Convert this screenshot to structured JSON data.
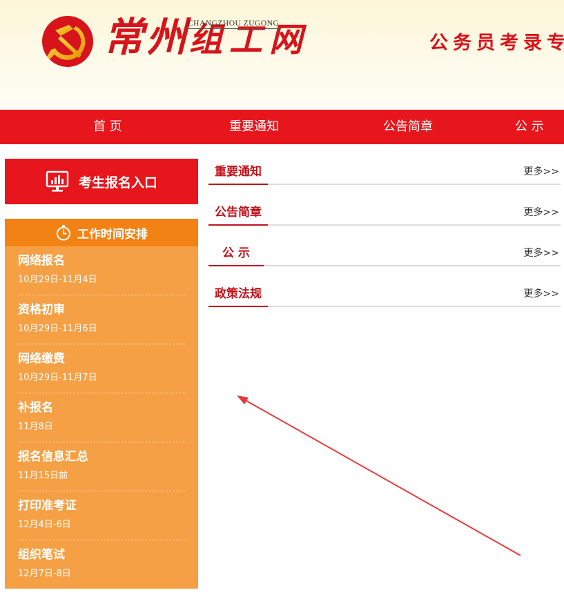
{
  "header": {
    "logo_part1": "常州",
    "logo_part2": "组工网",
    "logo_en": "CHANGZHOU ZUGONG",
    "banner_text": "公务员考录专"
  },
  "nav": {
    "items": [
      {
        "label": "首 页"
      },
      {
        "label": "重要通知"
      },
      {
        "label": "公告简章"
      },
      {
        "label": "公 示"
      }
    ]
  },
  "sidebar": {
    "signup_label": "考生报名入口",
    "schedule_title": "工作时间安排",
    "schedule": [
      {
        "name": "网络报名",
        "date": "10月29日-11月4日"
      },
      {
        "name": "资格初审",
        "date": "10月29日-11月6日"
      },
      {
        "name": "网络缴费",
        "date": "10月29日-11月7日"
      },
      {
        "name": "补报名",
        "date": "11月8日"
      },
      {
        "name": "报名信息汇总",
        "date": "11月15日前"
      },
      {
        "name": "打印准考证",
        "date": "12月4日-6日"
      },
      {
        "name": "组织笔试",
        "date": "12月7日-8日"
      }
    ]
  },
  "sections": [
    {
      "title": "重要通知",
      "more": "更多>>"
    },
    {
      "title": "公告简章",
      "more": "更多>>"
    },
    {
      "title": "公 示",
      "more": "更多>>"
    },
    {
      "title": "政策法规",
      "more": "更多>>"
    }
  ],
  "colors": {
    "brand_red": "#e6161c",
    "title_red": "#c0121a",
    "schedule_orange": "#f6a045",
    "schedule_head_orange": "#f38214",
    "emblem_gold": "#f5b400"
  }
}
